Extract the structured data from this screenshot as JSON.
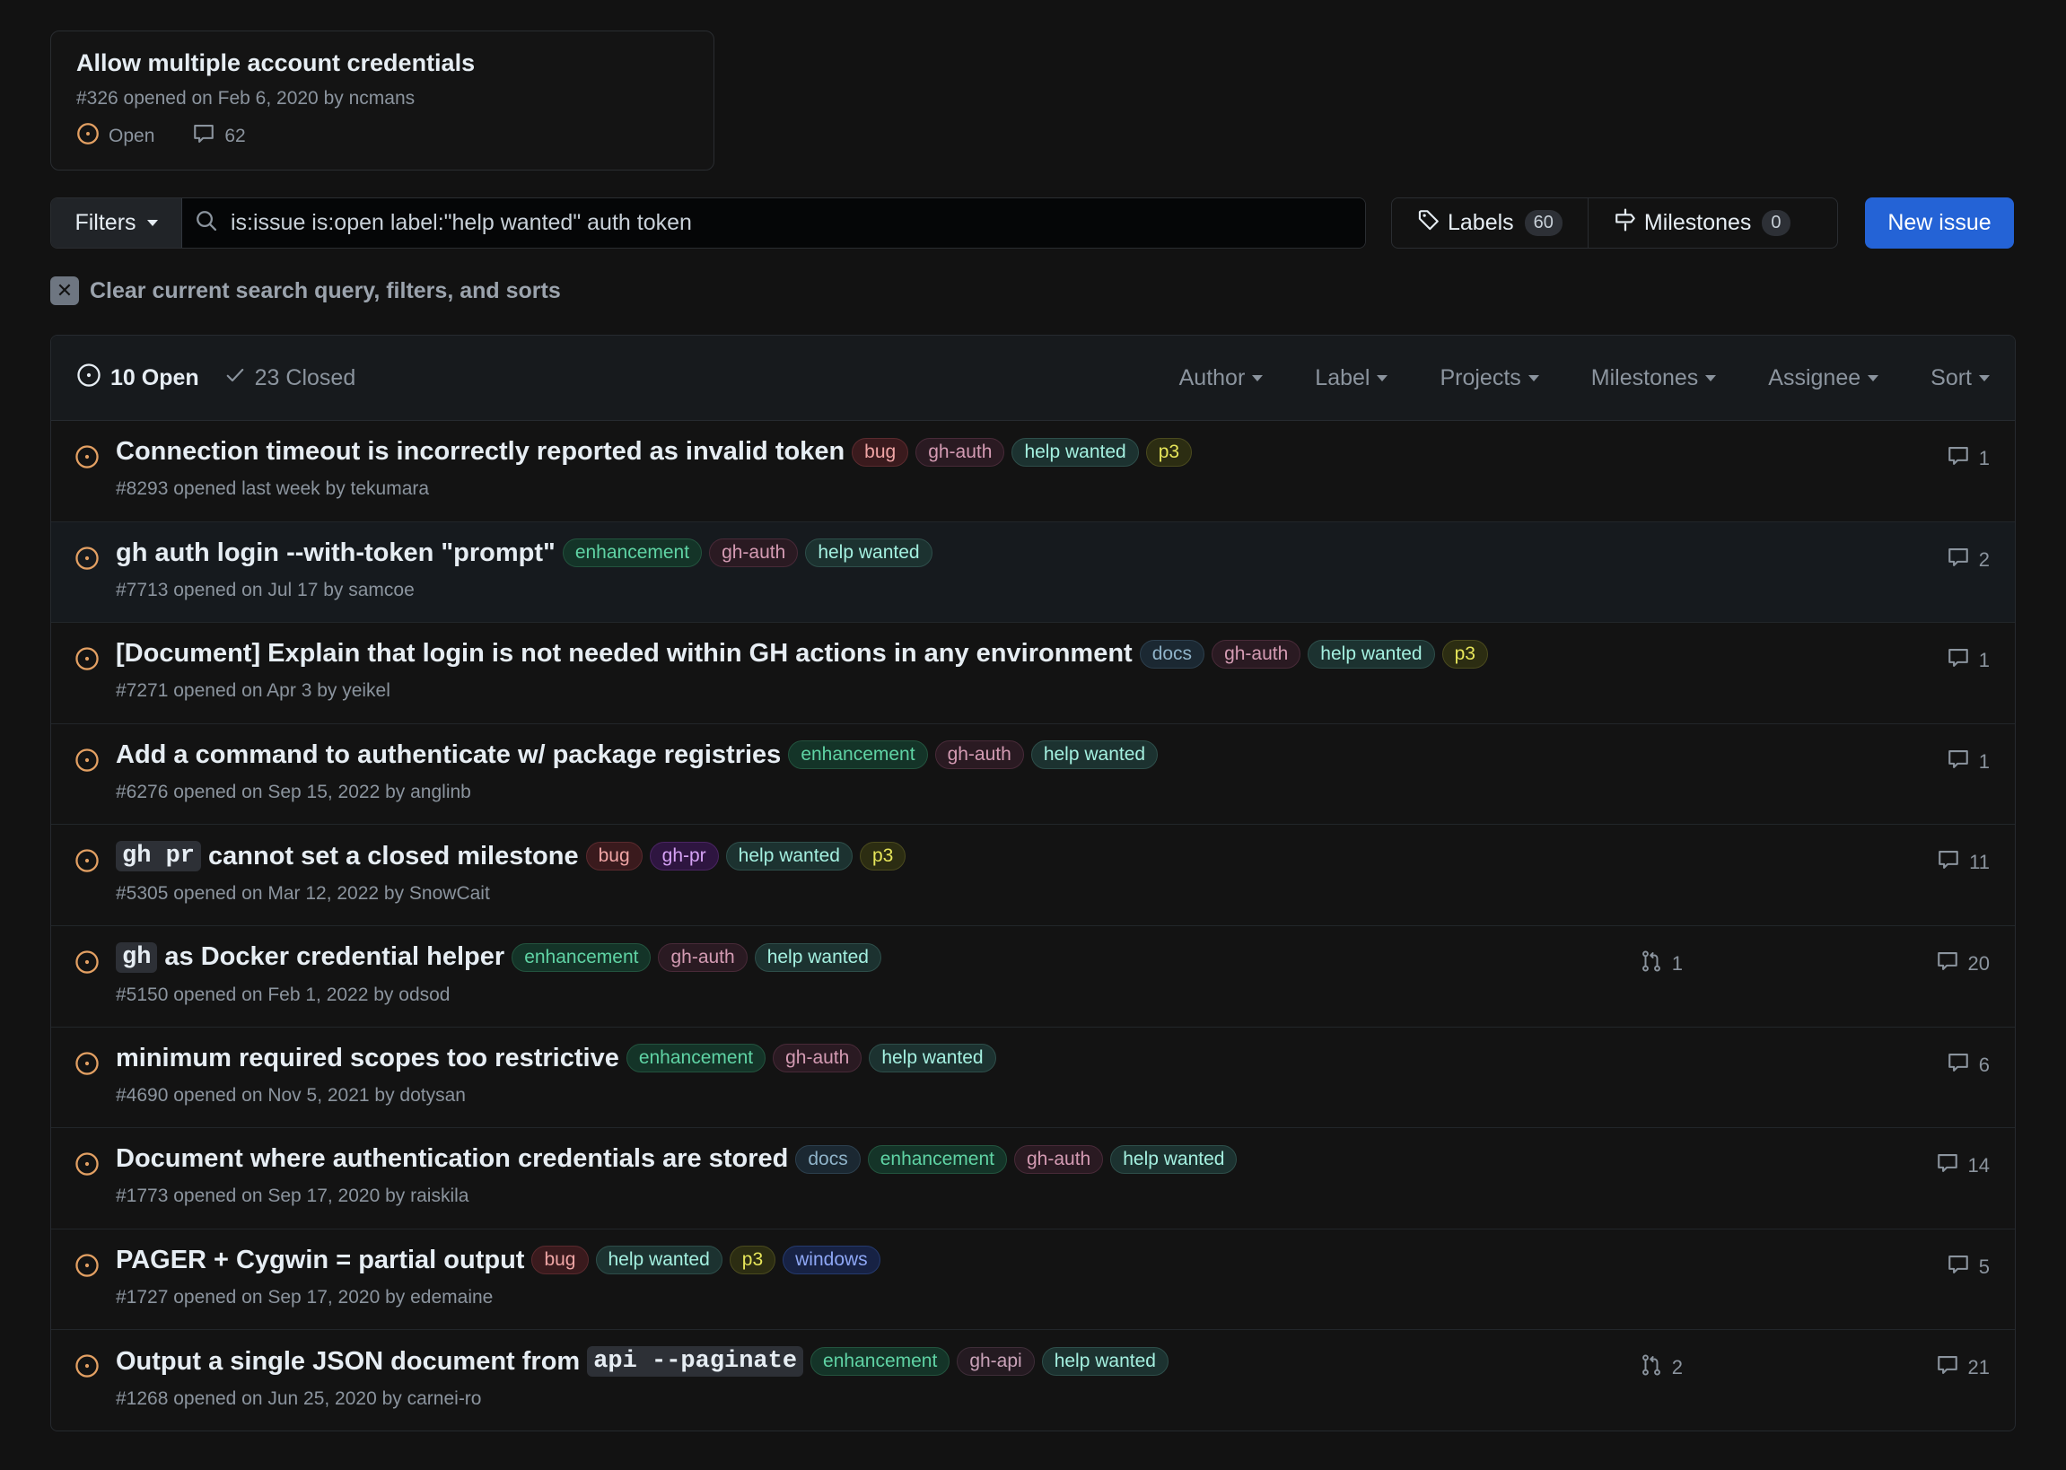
{
  "colors": {
    "open_icon": "#e3a063",
    "accent_blue": "#2463d6"
  },
  "pinned": {
    "title": "Allow multiple account credentials",
    "meta": "#326 opened on Feb 6, 2020 by ncmans",
    "state": "Open",
    "comments": "62"
  },
  "filters": {
    "button_label": "Filters",
    "query": "is:issue is:open label:\"help wanted\" auth token",
    "labels_label": "Labels",
    "labels_count": "60",
    "milestones_label": "Milestones",
    "milestones_count": "0",
    "new_issue_label": "New issue",
    "clear_label": "Clear current search query, filters, and sorts"
  },
  "list_header": {
    "open_label": "10 Open",
    "closed_label": "23 Closed",
    "sorts": [
      "Author",
      "Label",
      "Projects",
      "Milestones",
      "Assignee",
      "Sort"
    ]
  },
  "label_styles": {
    "bug": {
      "fg": "#f0a5a5",
      "bg": "#3a1a1d",
      "bd": "#5a2a2e"
    },
    "gh-auth": {
      "fg": "#d49bb3",
      "bg": "#2a1a22",
      "bd": "#482a38"
    },
    "help wanted": {
      "fg": "#a4f0e0",
      "bg": "#1c3230",
      "bd": "#2e4e4a"
    },
    "p3": {
      "fg": "#e7e65a",
      "bg": "#2c2d12",
      "bd": "#4a4a1e"
    },
    "enhancement": {
      "fg": "#5fd3a4",
      "bg": "#143428",
      "bd": "#23533e"
    },
    "docs": {
      "fg": "#8fb3c9",
      "bg": "#1b2832",
      "bd": "#2c3f4d"
    },
    "gh-pr": {
      "fg": "#d6a2f5",
      "bg": "#2e1540",
      "bd": "#4a2562"
    },
    "gh-api": {
      "fg": "#c9a2b8",
      "bg": "#241a21",
      "bd": "#3e2d38"
    },
    "windows": {
      "fg": "#8ea7f5",
      "bg": "#172244",
      "bd": "#253a6e"
    }
  },
  "issues": [
    {
      "title_parts": [
        {
          "text": "Connection timeout is incorrectly reported as invalid token"
        }
      ],
      "labels": [
        "bug",
        "gh-auth",
        "help wanted",
        "p3"
      ],
      "meta": "#8293 opened last week by tekumara",
      "comments": "1",
      "prs": null
    },
    {
      "title_parts": [
        {
          "text": "gh auth login --with-token \"prompt\""
        }
      ],
      "labels": [
        "enhancement",
        "gh-auth",
        "help wanted"
      ],
      "meta": "#7713 opened on Jul 17 by samcoe",
      "comments": "2",
      "prs": null
    },
    {
      "title_parts": [
        {
          "text": "[Document] Explain that login is not needed within GH actions in any environment"
        }
      ],
      "labels": [
        "docs",
        "gh-auth",
        "help wanted",
        "p3"
      ],
      "meta": "#7271 opened on Apr 3 by yeikel",
      "comments": "1",
      "prs": null
    },
    {
      "title_parts": [
        {
          "text": "Add a command to authenticate w/ package registries"
        }
      ],
      "labels": [
        "enhancement",
        "gh-auth",
        "help wanted"
      ],
      "meta": "#6276 opened on Sep 15, 2022 by anglinb",
      "comments": "1",
      "prs": null
    },
    {
      "title_parts": [
        {
          "code": "gh pr"
        },
        {
          "text": "cannot set a closed milestone"
        }
      ],
      "labels": [
        "bug",
        "gh-pr",
        "help wanted",
        "p3"
      ],
      "meta": "#5305 opened on Mar 12, 2022 by SnowCait",
      "comments": "11",
      "prs": null
    },
    {
      "title_parts": [
        {
          "code": "gh"
        },
        {
          "text": "as Docker credential helper"
        }
      ],
      "labels": [
        "enhancement",
        "gh-auth",
        "help wanted"
      ],
      "meta": "#5150 opened on Feb 1, 2022 by odsod",
      "comments": "20",
      "prs": "1"
    },
    {
      "title_parts": [
        {
          "text": "minimum required scopes too restrictive"
        }
      ],
      "labels": [
        "enhancement",
        "gh-auth",
        "help wanted"
      ],
      "meta": "#4690 opened on Nov 5, 2021 by dotysan",
      "comments": "6",
      "prs": null
    },
    {
      "title_parts": [
        {
          "text": "Document where authentication credentials are stored"
        }
      ],
      "labels": [
        "docs",
        "enhancement",
        "gh-auth",
        "help wanted"
      ],
      "meta": "#1773 opened on Sep 17, 2020 by raiskila",
      "comments": "14",
      "prs": null
    },
    {
      "title_parts": [
        {
          "text": "PAGER + Cygwin = partial output"
        }
      ],
      "labels": [
        "bug",
        "help wanted",
        "p3",
        "windows"
      ],
      "meta": "#1727 opened on Sep 17, 2020 by edemaine",
      "comments": "5",
      "prs": null
    },
    {
      "title_parts": [
        {
          "text": "Output a single JSON document from"
        },
        {
          "code": "api --paginate"
        }
      ],
      "labels": [
        "enhancement",
        "gh-api",
        "help wanted"
      ],
      "meta": "#1268 opened on Jun 25, 2020 by carnei-ro",
      "comments": "21",
      "prs": "2"
    }
  ]
}
